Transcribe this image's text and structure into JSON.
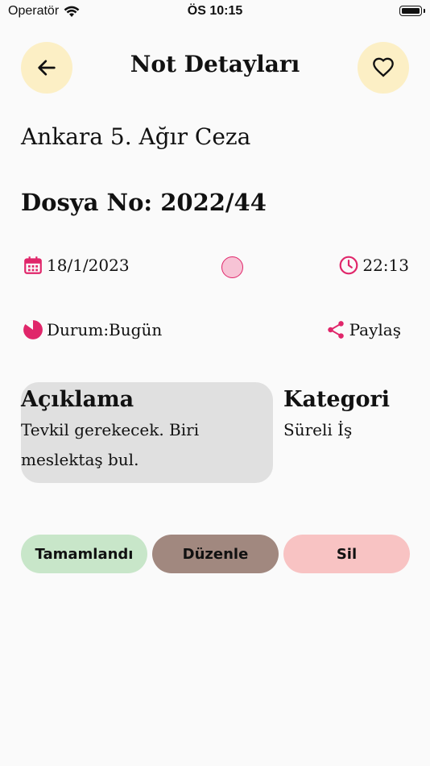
{
  "status_bar": {
    "carrier": "Operatör",
    "time": "ÖS 10:15"
  },
  "header": {
    "title": "Not Detayları"
  },
  "note": {
    "court": "Ankara 5. Ağır Ceza",
    "file_no": "Dosya No: 2022/44",
    "date": "18/1/2023",
    "time": "22:13",
    "status": "Durum:Bugün",
    "share_label": "Paylaş",
    "description_title": "Açıklama",
    "description_text": "Tevkil gerekecek. Biri meslektaş bul.",
    "category_title": "Kategori",
    "category_value": "Süreli İş"
  },
  "actions": {
    "complete": "Tamamlandı",
    "edit": "Düzenle",
    "delete": "Sil"
  },
  "colors": {
    "accent": "#e0266a",
    "icon_btn_bg": "#fcefc5",
    "card_bg": "#e0e0e0",
    "complete_bg": "#c8e6c9",
    "edit_bg": "#a1887f",
    "delete_bg": "#f8c3c3",
    "note_color": "#f7c3d5"
  },
  "icons": {
    "back": "arrow-left-icon",
    "favorite": "heart-outline-icon",
    "date": "calendar-icon",
    "time": "clock-icon",
    "status": "pie-icon",
    "share": "share-icon"
  }
}
